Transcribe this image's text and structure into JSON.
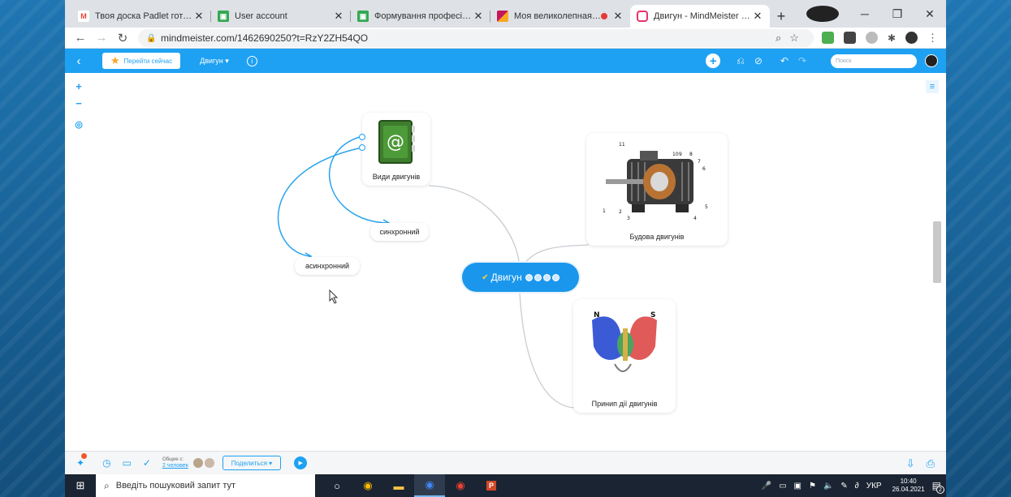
{
  "browser": {
    "tabs": [
      {
        "title": "Твоя доска Padlet готова! - ",
        "favicon_color": "#ea4335",
        "favicon_glyph": "M"
      },
      {
        "title": "User account",
        "favicon_color": "#34a853",
        "favicon_glyph": "▣"
      },
      {
        "title": "Формування професійної ко",
        "favicon_color": "#34a853",
        "favicon_glyph": "▣"
      },
      {
        "title": "Моя великолепная доск",
        "favicon_color": "#c2185b",
        "favicon_glyph": "■"
      },
      {
        "title": "Двигун - MindMeister мента",
        "favicon_color": "#e8336a",
        "favicon_glyph": "◉",
        "active": true
      }
    ],
    "url": "mindmeister.com/1462690250?t=RzY2ZH54QO"
  },
  "mindmeister": {
    "goto_label": "Перейти сейчас",
    "map_menu_label": "Двигун ▾",
    "search_placeholder": "Поиск"
  },
  "map": {
    "center_label": "Двигун",
    "nodes": {
      "types": "Види двигунів",
      "sync": "синхронний",
      "async": "асинхронний",
      "structure": "Будова двигунів",
      "principle": "Принип дії двигунів"
    },
    "engine_part_numbers": [
      "11",
      "10",
      "9",
      "8",
      "7",
      "6",
      "5",
      "4",
      "3",
      "2",
      "1"
    ],
    "magnet_labels": {
      "north": "N",
      "south": "S"
    },
    "colors": {
      "accent": "#1ea1f2",
      "center": "#1a97ec",
      "link_line": "#c8cdd2"
    }
  },
  "bottombar": {
    "viewers_label": "Общие с:",
    "viewers_link": "2 человек",
    "share_label": "Поделиться ▾"
  },
  "taskbar": {
    "search_placeholder": "Введіть пошуковий запит тут",
    "language": "УКР",
    "time": "10:40",
    "date": "26.04.2021",
    "notifications": "2"
  }
}
